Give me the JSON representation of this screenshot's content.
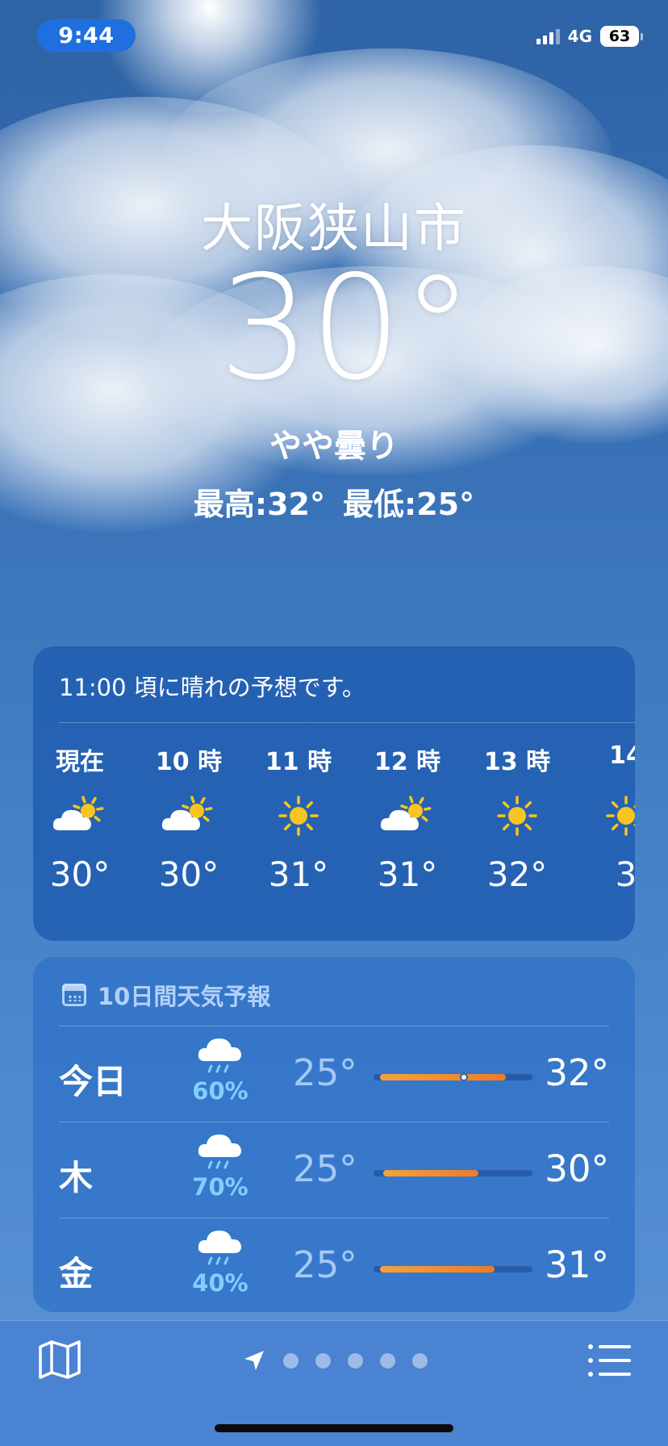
{
  "status_bar": {
    "time": "9:44",
    "network": "4G",
    "battery": "63"
  },
  "location": {
    "city": "大阪狭山市",
    "temperature": "30°",
    "condition": "やや曇り",
    "high": "最高:32°",
    "low": "最低:25°"
  },
  "hourly": {
    "message": "11:00 頃に晴れの予想です。",
    "hours": [
      {
        "label": "現在",
        "icon": "partly-sunny-icon",
        "temp": "30°"
      },
      {
        "label": "10 時",
        "icon": "partly-sunny-icon",
        "temp": "30°"
      },
      {
        "label": "11 時",
        "icon": "sun-icon",
        "temp": "31°"
      },
      {
        "label": "12 時",
        "icon": "partly-sunny-icon",
        "temp": "31°"
      },
      {
        "label": "13 時",
        "icon": "sun-icon",
        "temp": "32°"
      },
      {
        "label": "14",
        "icon": "sun-icon",
        "temp": "3"
      }
    ]
  },
  "daily": {
    "title": "10日間天気予報",
    "days": [
      {
        "day": "今日",
        "icon": "rain-cloud-icon",
        "precip": "60%",
        "low": "25°",
        "high": "32°",
        "range_start": 0.04,
        "range_end": 0.83,
        "current_marker": 0.57
      },
      {
        "day": "木",
        "icon": "rain-cloud-icon",
        "precip": "70%",
        "low": "25°",
        "high": "30°",
        "range_start": 0.06,
        "range_end": 0.66
      },
      {
        "day": "金",
        "icon": "rain-cloud-icon",
        "precip": "40%",
        "low": "25°",
        "high": "31°",
        "range_start": 0.04,
        "range_end": 0.76
      }
    ]
  },
  "bottom_bar": {
    "page_count": 5
  },
  "colors": {
    "sun": "#f7c51e",
    "precip": "#7fd0ff",
    "bar": "#f07a26",
    "time_pill": "#1f6fe0"
  }
}
